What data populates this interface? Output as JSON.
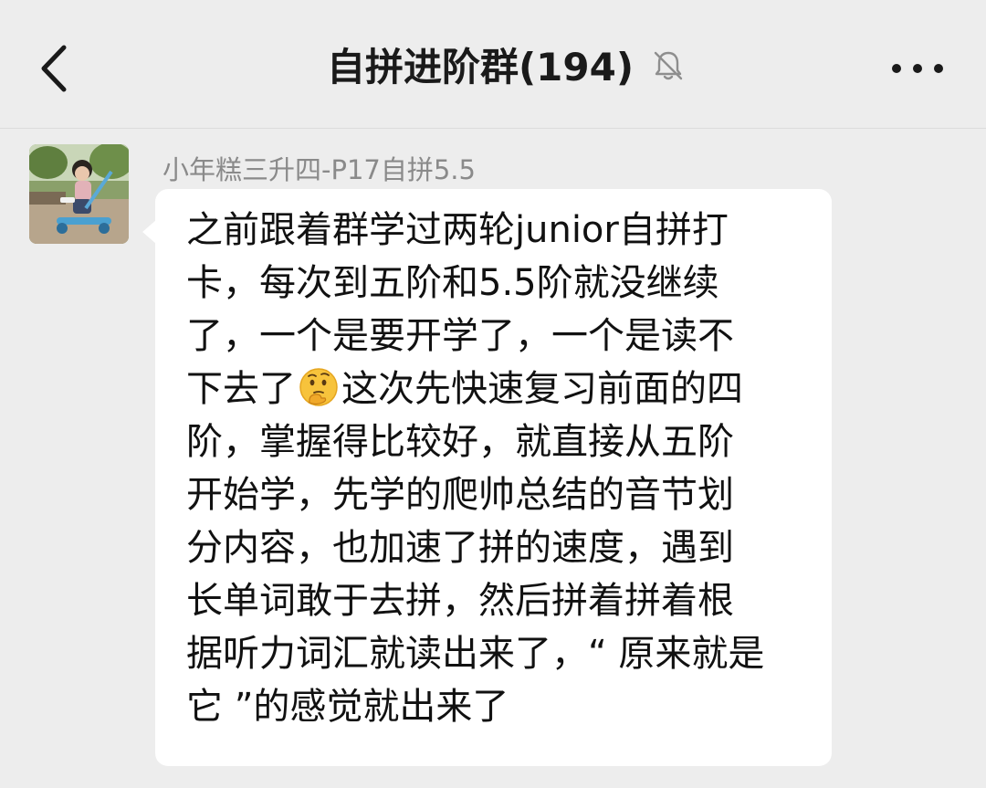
{
  "header": {
    "title": "自拼进阶群(194)",
    "back_icon": "chevron-left-icon",
    "mute_icon": "bell-off-icon",
    "more_icon": "more-dots-icon"
  },
  "message": {
    "sender": "小年糕三升四-P17自拼5.5",
    "lines": {
      "l1": "之前跟着群学过两轮junior自拼打",
      "l2": "卡，每次到五阶和5.5阶就没继续",
      "l3": "了，一个是要开学了，一个是读不",
      "l4a": "下去了",
      "l4b": "这次先快速复习前面的四",
      "l5": "阶，掌握得比较好，就直接从五阶",
      "l6": "开始学，先学的爬帅总结的音节划",
      "l7": "分内容，也加速了拼的速度，遇到",
      "l8": "长单词敢于去拼，然后拼着拼着根",
      "l9": "据听力词汇就读出来了，“ 原来就是",
      "l10": "它 ”的感觉就出来了"
    },
    "emoji": "thinking-face-emoji"
  },
  "colors": {
    "background": "#ededed",
    "bubble": "#ffffff",
    "sender_text": "#8a8a8a",
    "message_text": "#111111"
  }
}
